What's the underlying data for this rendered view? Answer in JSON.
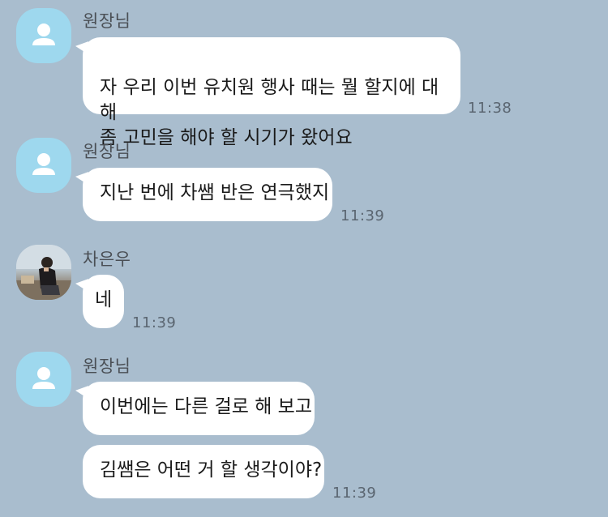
{
  "messages": [
    {
      "sender": "원장님",
      "avatar": "default-person-icon",
      "bubbles": [
        "자 우리 이번 유치원 행사 때는 뭘 할지에 대해\n좀 고민을 해야 할 시기가 왔어요"
      ],
      "time": "11:38"
    },
    {
      "sender": "원장님",
      "avatar": "default-person-icon",
      "bubbles": [
        "지난 번에 차쌤 반은 연극했지"
      ],
      "time": "11:39"
    },
    {
      "sender": "차은우",
      "avatar": "profile-photo",
      "bubbles": [
        "네"
      ],
      "time": "11:39"
    },
    {
      "sender": "원장님",
      "avatar": "default-person-icon",
      "bubbles": [
        "이번에는 다른 걸로 해 보고",
        "김쌤은 어떤 거 할 생각이야?"
      ],
      "time": "11:39"
    }
  ],
  "colors": {
    "background": "#a9bdce",
    "bubble": "#ffffff",
    "default_avatar": "#9ed8ee"
  }
}
